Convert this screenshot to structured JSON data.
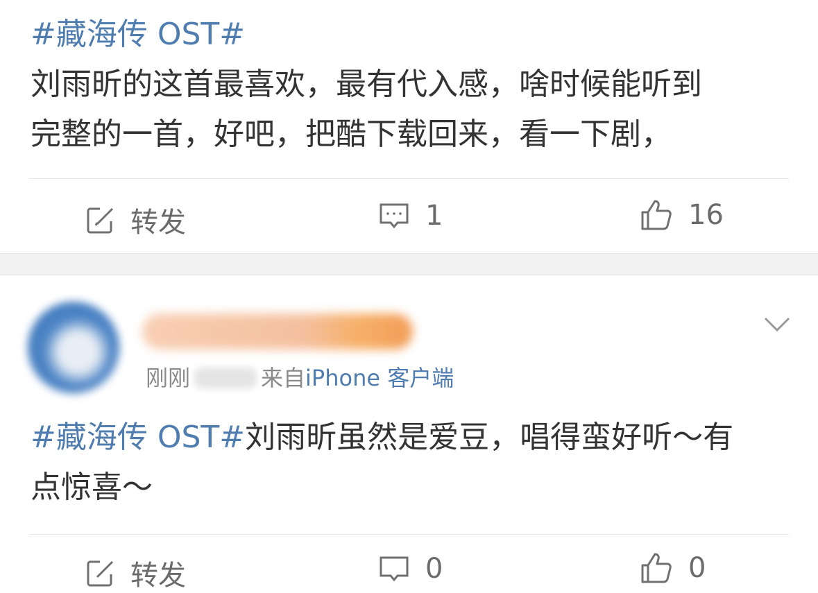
{
  "posts": [
    {
      "topic": "#藏海传 OST#",
      "line1": "刘雨昕的这首最喜欢，最有代入感，啥时候能听到",
      "line2": "完整的一首，好吧，把酷下载回来，看一下剧，",
      "actions": {
        "repost_label": "转发",
        "comment_count": "1",
        "like_count": "16"
      }
    },
    {
      "time_prefix": "刚刚",
      "source_prefix": "来自",
      "source": "iPhone 客户端",
      "topic": "#藏海传 OST#",
      "text_rest": "刘雨昕虽然是爱豆，唱得蛮好听～有",
      "line2": "点惊喜～",
      "actions": {
        "repost_label": "转发",
        "comment_count": "0",
        "like_count": "0"
      }
    }
  ],
  "icons": {
    "repost": "repost-icon",
    "comment": "comment-icon",
    "like": "like-icon",
    "more": "chevron-down-icon"
  },
  "colors": {
    "topic": "#507daf",
    "text": "#333333",
    "muted": "#8a8a8a",
    "separator": "#f2f2f2"
  }
}
